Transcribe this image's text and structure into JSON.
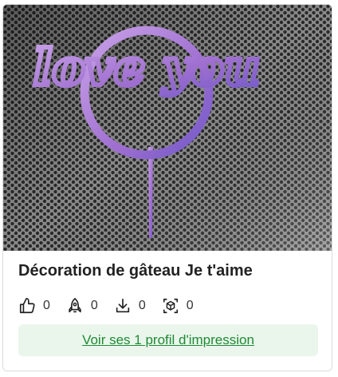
{
  "card": {
    "image_alt": "Décoration de gâteau Je t'aime",
    "artwork_text": "love you",
    "title": "Décoration de gâteau Je t'aime",
    "stats": [
      {
        "icon": "thumbs-up-icon",
        "count": "0"
      },
      {
        "icon": "rocket-icon",
        "count": "0"
      },
      {
        "icon": "download-icon",
        "count": "0"
      },
      {
        "icon": "3d-cube-icon",
        "count": "0"
      }
    ],
    "cta_label": "Voir ses 1 profil d'impression"
  },
  "colors": {
    "title": "#222222",
    "cta_background": "#eaf6ec",
    "cta_text": "#1f8a35",
    "print_purple": "#b48ad6"
  }
}
